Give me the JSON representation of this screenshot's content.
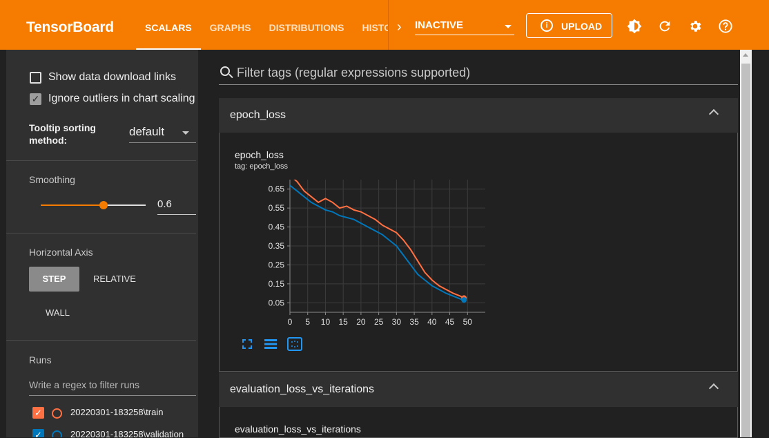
{
  "app": {
    "title": "TensorBoard"
  },
  "tabs": [
    {
      "label": "SCALARS",
      "active": true
    },
    {
      "label": "GRAPHS"
    },
    {
      "label": "DISTRIBUTIONS"
    },
    {
      "label": "HISTOGRAMS"
    }
  ],
  "plugin_select": {
    "value": "INACTIVE"
  },
  "upload": {
    "label": "UPLOAD"
  },
  "toolbar_icons": [
    "theme-toggle-icon",
    "reload-icon",
    "settings-icon",
    "help-icon"
  ],
  "sidebar": {
    "show_download": {
      "label": "Show data download links",
      "checked": false
    },
    "ignore_outliers": {
      "label": "Ignore outliers in chart scaling",
      "checked": true
    },
    "tooltip_sort": {
      "label": "Tooltip sorting method:",
      "value": "default"
    },
    "smoothing": {
      "label": "Smoothing",
      "value": "0.6",
      "fraction": 0.6
    },
    "horizontal_axis": {
      "label": "Horizontal Axis",
      "options": [
        "STEP",
        "RELATIVE",
        "WALL"
      ],
      "selected": "STEP"
    },
    "runs": {
      "label": "Runs",
      "filter_placeholder": "Write a regex to filter runs",
      "items": [
        {
          "name": "20220301-183258\\train",
          "color": "#ff7043",
          "checked": true
        },
        {
          "name": "20220301-183258\\validation",
          "color": "#0077bb",
          "checked": true
        }
      ]
    }
  },
  "main": {
    "filter_placeholder": "Filter tags (regular expressions supported)",
    "cards": [
      {
        "header": "epoch_loss",
        "chart_title": "epoch_loss",
        "chart_tag": "tag: epoch_loss"
      },
      {
        "header": "evaluation_loss_vs_iterations",
        "chart_title": "evaluation_loss_vs_iterations"
      }
    ]
  },
  "colors": {
    "accent": "#f57c00",
    "train": "#ff7043",
    "validation": "#0077bb"
  },
  "chart_data": {
    "type": "line",
    "title": "epoch_loss",
    "subtitle": "tag: epoch_loss",
    "xlabel": "",
    "ylabel": "",
    "xlim": [
      0,
      55
    ],
    "ylim": [
      0.0,
      0.7
    ],
    "xticks": [
      0,
      5,
      10,
      15,
      20,
      25,
      30,
      35,
      40,
      45,
      50
    ],
    "yticks": [
      0.05,
      0.15,
      0.25,
      0.35,
      0.45,
      0.55,
      0.65
    ],
    "ytick_labels": [
      "0.05",
      "0.15",
      "0.25",
      "0.35",
      "0.45",
      "0.55",
      "0.65"
    ],
    "grid": true,
    "series": [
      {
        "name": "20220301-183258\\train",
        "color": "#ff7043",
        "x": [
          0,
          2,
          4,
          6,
          8,
          10,
          12,
          14,
          16,
          18,
          20,
          22,
          24,
          26,
          28,
          30,
          32,
          34,
          36,
          38,
          40,
          42,
          44,
          46,
          48,
          49
        ],
        "y": [
          0.72,
          0.69,
          0.64,
          0.61,
          0.58,
          0.6,
          0.58,
          0.55,
          0.56,
          0.54,
          0.53,
          0.51,
          0.49,
          0.46,
          0.44,
          0.42,
          0.38,
          0.33,
          0.27,
          0.21,
          0.17,
          0.14,
          0.12,
          0.1,
          0.085,
          0.075
        ]
      },
      {
        "name": "20220301-183258\\validation",
        "color": "#0077bb",
        "x": [
          0,
          2,
          4,
          6,
          8,
          10,
          12,
          14,
          16,
          18,
          20,
          22,
          24,
          26,
          28,
          30,
          32,
          34,
          36,
          38,
          40,
          42,
          44,
          46,
          48,
          49
        ],
        "y": [
          0.67,
          0.64,
          0.61,
          0.58,
          0.56,
          0.54,
          0.53,
          0.51,
          0.5,
          0.49,
          0.47,
          0.45,
          0.43,
          0.41,
          0.38,
          0.35,
          0.3,
          0.25,
          0.2,
          0.17,
          0.14,
          0.12,
          0.1,
          0.085,
          0.07,
          0.065
        ]
      }
    ]
  }
}
